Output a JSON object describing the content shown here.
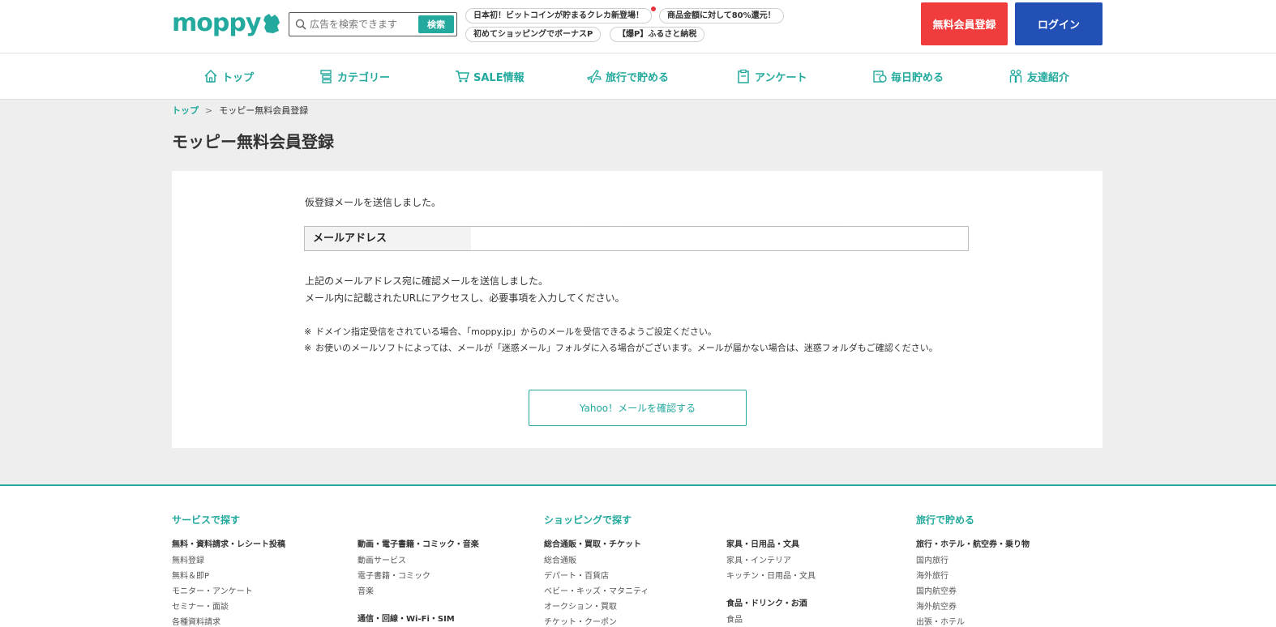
{
  "header": {
    "logo_text": "moppy",
    "search": {
      "placeholder": "広告を検索できます",
      "value": "",
      "button_label": "検索"
    },
    "tags": [
      "日本初！ビットコインが貯まるクレカ新登場！",
      "商品金額に対して80%還元！",
      "初めてショッピングでボーナスP",
      "【爆P】ふるさと納税"
    ],
    "register_label": "無料会員登録",
    "login_label": "ログイン"
  },
  "nav": [
    {
      "label": "トップ",
      "icon": "home-icon"
    },
    {
      "label": "カテゴリー",
      "icon": "list-icon"
    },
    {
      "label": "SALE情報",
      "icon": "cart-icon"
    },
    {
      "label": "旅行で貯める",
      "icon": "plane-icon"
    },
    {
      "label": "アンケート",
      "icon": "clipboard-icon"
    },
    {
      "label": "毎日貯める",
      "icon": "calendar-coin-icon"
    },
    {
      "label": "友達紹介",
      "icon": "friends-icon"
    }
  ],
  "breadcrumb": {
    "home": "トップ",
    "separator": ">",
    "current": "モッピー無料会員登録"
  },
  "page_title": "モッピー無料会員登録",
  "card": {
    "lead": "仮登録メールを送信しました。",
    "email_label": "メールアドレス",
    "email_value": "",
    "message_lines": [
      "上記のメールアドレス宛に確認メールを送信しました。",
      "メール内に記載されたURLにアクセスし、必要事項を入力してください。"
    ],
    "notes": [
      {
        "mark": "※",
        "text": "ドメイン指定受信をされている場合、「moppy.jp」からのメールを受信できるようご設定ください。"
      },
      {
        "mark": "※",
        "text": "お使いのメールソフトによっては、メールが「迷惑メール」フォルダに入る場合がございます。メールが届かない場合は、迷惑フォルダもご確認ください。"
      }
    ],
    "yahoo_button": "Yahoo！メールを確認する"
  },
  "footer": {
    "headings": [
      "サービスで探す",
      "ショッピングで探す",
      "旅行で貯める"
    ],
    "col1": {
      "title": "無料・資料請求・レシート投稿",
      "links": [
        "無料登録",
        "無料＆即P",
        "モニター・アンケート",
        "セミナー・面談",
        "各種資料請求"
      ]
    },
    "col2": {
      "title": "動画・電子書籍・コミック・音楽",
      "links": [
        "動画サービス",
        "電子書籍・コミック",
        "音楽"
      ],
      "title2": "通信・回線・Wi-Fi・SIM"
    },
    "col3": {
      "title": "総合通販・買取・チケット",
      "links": [
        "総合通販",
        "デパート・百貨店",
        "ベビー・キッズ・マタニティ",
        "オークション・買取",
        "チケット・クーポン"
      ]
    },
    "col4": {
      "title": "家具・日用品・文具",
      "links": [
        "家具・インテリア",
        "キッチン・日用品・文具"
      ],
      "title2": "食品・ドリンク・お酒",
      "links2": [
        "食品"
      ]
    },
    "col5": {
      "title": "旅行・ホテル・航空券・乗り物",
      "links": [
        "国内旅行",
        "海外旅行",
        "国内航空券",
        "海外航空券",
        "出張・ホテル"
      ]
    }
  },
  "colors": {
    "brand": "#23a99d",
    "register": "#f03c3c",
    "login": "#2350b5",
    "page_bg": "#eeeeee"
  }
}
